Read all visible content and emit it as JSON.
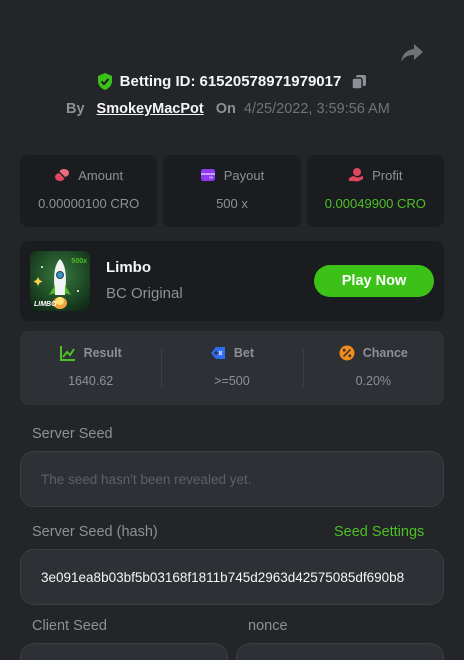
{
  "header": {
    "betting_id_label": "Betting ID:",
    "betting_id": "61520578971979017",
    "by_label": "By",
    "username": "SmokeyMacPot",
    "on_label": "On",
    "datetime": "4/25/2022, 3:59:56 AM"
  },
  "stats": [
    {
      "label": "Amount",
      "value": "0.00000100 CRO",
      "icon": "coins-icon"
    },
    {
      "label": "Payout",
      "value": "500 x",
      "icon": "wallet-icon"
    },
    {
      "label": "Profit",
      "value": "0.00049900 CRO",
      "icon": "hand-coin-icon"
    }
  ],
  "game": {
    "name": "Limbo",
    "subtitle": "BC Original",
    "thumb_text": "LIMBO",
    "thumb_badge": "500x",
    "play_label": "Play Now"
  },
  "result": [
    {
      "label": "Result",
      "value": "1640.62",
      "icon": "chart-up-icon"
    },
    {
      "label": "Bet",
      "value": ">=500",
      "icon": "ticket-icon"
    },
    {
      "label": "Chance",
      "value": "0.20%",
      "icon": "percent-icon"
    }
  ],
  "seeds": {
    "server_seed_label": "Server Seed",
    "server_seed_placeholder": "The seed hasn't been revealed yet.",
    "server_hash_label": "Server Seed (hash)",
    "seed_settings_label": "Seed Settings",
    "server_hash_value": "3e091ea8b03bf5b03168f1811b745d2963d42575085df690b8",
    "client_seed_label": "Client Seed",
    "nonce_label": "nonce"
  },
  "colors": {
    "background": "#232528",
    "card": "#1a1c1f",
    "accent_green": "#3bc117",
    "profit_green": "#4dc024"
  }
}
